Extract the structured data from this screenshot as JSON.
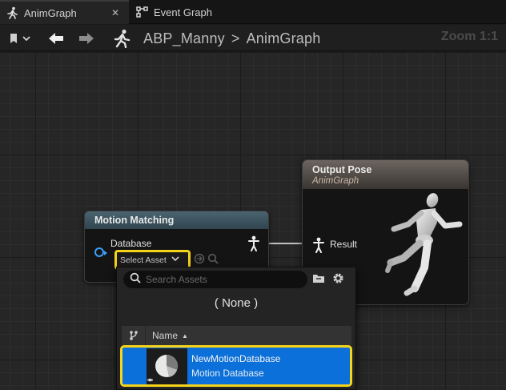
{
  "tabs": [
    {
      "label": "AnimGraph",
      "icon": "running-figure-icon",
      "active": true
    },
    {
      "label": "Event Graph",
      "icon": "graph-nodes-icon",
      "active": false
    }
  ],
  "toolbar": {
    "breadcrumb": [
      "ABP_Manny",
      "AnimGraph"
    ],
    "breadcrumb_separator": ">",
    "zoom": "Zoom 1:1"
  },
  "nodes": {
    "motion_matching": {
      "title": "Motion Matching",
      "input_label": "Database",
      "select_asset_label": "Select Asset"
    },
    "output_pose": {
      "title": "Output Pose",
      "subtitle": "AnimGraph",
      "result_label": "Result"
    }
  },
  "asset_picker": {
    "search_placeholder": "Search Assets",
    "none_label": "( None )",
    "column_name": "Name",
    "items": [
      {
        "name": "NewMotionDatabase",
        "type": "Motion Database",
        "selected": true
      }
    ]
  },
  "colors": {
    "highlight": "#f4d31b",
    "selection": "#0b70d9",
    "pin_blue": "#3aa0ff"
  }
}
